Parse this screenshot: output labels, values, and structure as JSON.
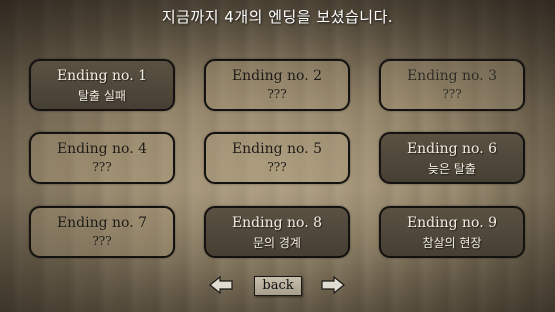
{
  "header": {
    "text": "지금까지 4개의 엔딩을 보셨습니다."
  },
  "endings": [
    {
      "title": "Ending no. 1",
      "subtitle": "탈출 실패",
      "state": "unlocked"
    },
    {
      "title": "Ending no. 2",
      "subtitle": "???",
      "state": "locked"
    },
    {
      "title": "Ending no. 3",
      "subtitle": "???",
      "state": "locked"
    },
    {
      "title": "Ending no. 4",
      "subtitle": "???",
      "state": "locked"
    },
    {
      "title": "Ending no. 5",
      "subtitle": "???",
      "state": "locked"
    },
    {
      "title": "Ending no. 6",
      "subtitle": "늦은 탈출",
      "state": "unlocked"
    },
    {
      "title": "Ending no. 7",
      "subtitle": "???",
      "state": "locked"
    },
    {
      "title": "Ending no. 8",
      "subtitle": "문의 경계",
      "state": "unlocked"
    },
    {
      "title": "Ending no. 9",
      "subtitle": "참살의 현장",
      "state": "unlocked"
    }
  ],
  "nav": {
    "back_label": "back",
    "prev_icon": "arrow-left-icon",
    "next_icon": "arrow-right-icon"
  },
  "colors": {
    "card_border": "#141210",
    "unlocked_fill": "#4f473a",
    "text_light": "#f2ede2",
    "text_dark": "#1c1914"
  }
}
